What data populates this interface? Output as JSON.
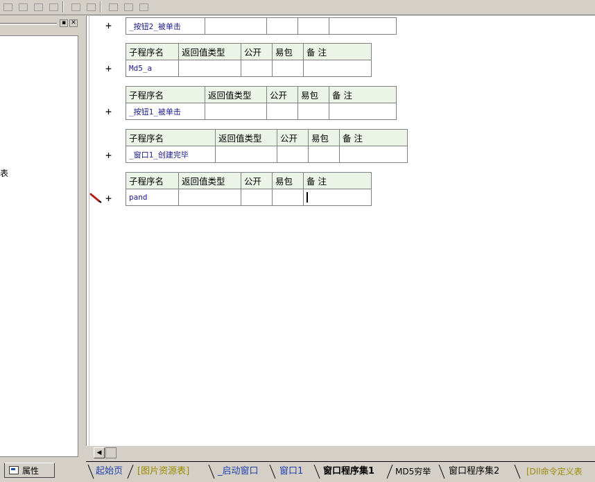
{
  "left_panel": {
    "tree_fragment": "表",
    "properties_tab_label": "属性",
    "minimize_glyph": "▪",
    "close_glyph": "✕"
  },
  "editor": {
    "header_columns": [
      "子程序名",
      "返回值类型",
      "公开",
      "易包",
      "备 注"
    ],
    "subroutines": [
      {
        "name": "_按钮2_被单击",
        "show_header": false
      },
      {
        "name": "Md5_a",
        "show_header": true
      },
      {
        "name": "_按钮1_被单击",
        "show_header": true
      },
      {
        "name": "_窗口1_创建完毕",
        "show_header": true
      },
      {
        "name": "pand",
        "show_header": true,
        "editing": true
      }
    ],
    "expand_glyph": "+"
  },
  "bottom_tabs": [
    {
      "label": "起始页",
      "style": "blue"
    },
    {
      "label": "[图片资源表]",
      "style": "yellow"
    },
    {
      "label": "_启动窗口",
      "style": "blue"
    },
    {
      "label": "窗口1",
      "style": "blue"
    },
    {
      "label": "窗口程序集1",
      "style": "active"
    },
    {
      "label": "MD5穷举",
      "style": "dark"
    },
    {
      "label": "窗口程序集2",
      "style": "dark"
    },
    {
      "label": "[Dll命令定义表",
      "style": "yellow"
    }
  ],
  "scrollbar": {
    "left_arrow": "◀"
  },
  "colors": {
    "header_bg": "#ecf4e8",
    "name_text": "#1a1a8c",
    "pen": "#b0201a"
  }
}
